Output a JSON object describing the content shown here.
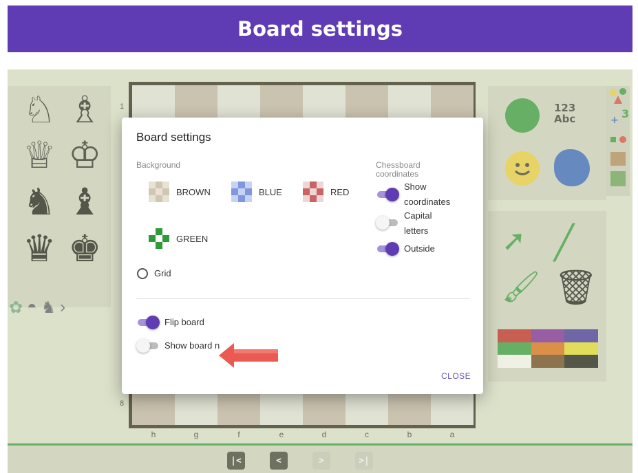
{
  "banner": {
    "title": "Board settings"
  },
  "board": {
    "ranks": [
      "1",
      "8"
    ],
    "files": [
      "h",
      "g",
      "f",
      "e",
      "d",
      "c",
      "b",
      "a"
    ]
  },
  "right_tools": {
    "abc_top": "123",
    "abc_bottom": "Abc"
  },
  "nav": {
    "first": "|<",
    "prev": "<",
    "next": ">",
    "last": ">|"
  },
  "dialog": {
    "title": "Board settings",
    "background_label": "Background",
    "backgrounds": [
      {
        "label": "BROWN",
        "colors": [
          "#e8e2d4",
          "#cfc7b4"
        ]
      },
      {
        "label": "BLUE",
        "colors": [
          "#c7d3f2",
          "#7e97df"
        ]
      },
      {
        "label": "RED",
        "colors": [
          "#efd6d6",
          "#c96464"
        ]
      },
      {
        "label": "GREEN",
        "colors": [
          "#ffffff",
          "#2f9a3a"
        ]
      }
    ],
    "grid_label": "Grid",
    "coords_label_line1": "Chessboard",
    "coords_label_line2": "coordinates",
    "show_coords_line1": "Show",
    "show_coords_line2": "coordinates",
    "capital_line1": "Capital",
    "capital_line2": "letters",
    "outside_label": "Outside",
    "flip_board_label": "Flip board",
    "show_board_label": "Show board n",
    "close_label": "CLOSE",
    "toggles": {
      "show_coordinates": true,
      "capital_letters": false,
      "outside": true,
      "flip_board": true,
      "show_board": false
    }
  },
  "colors": {
    "accent": "#5f3cb3",
    "annotation_arrow": "#ea5a52"
  }
}
